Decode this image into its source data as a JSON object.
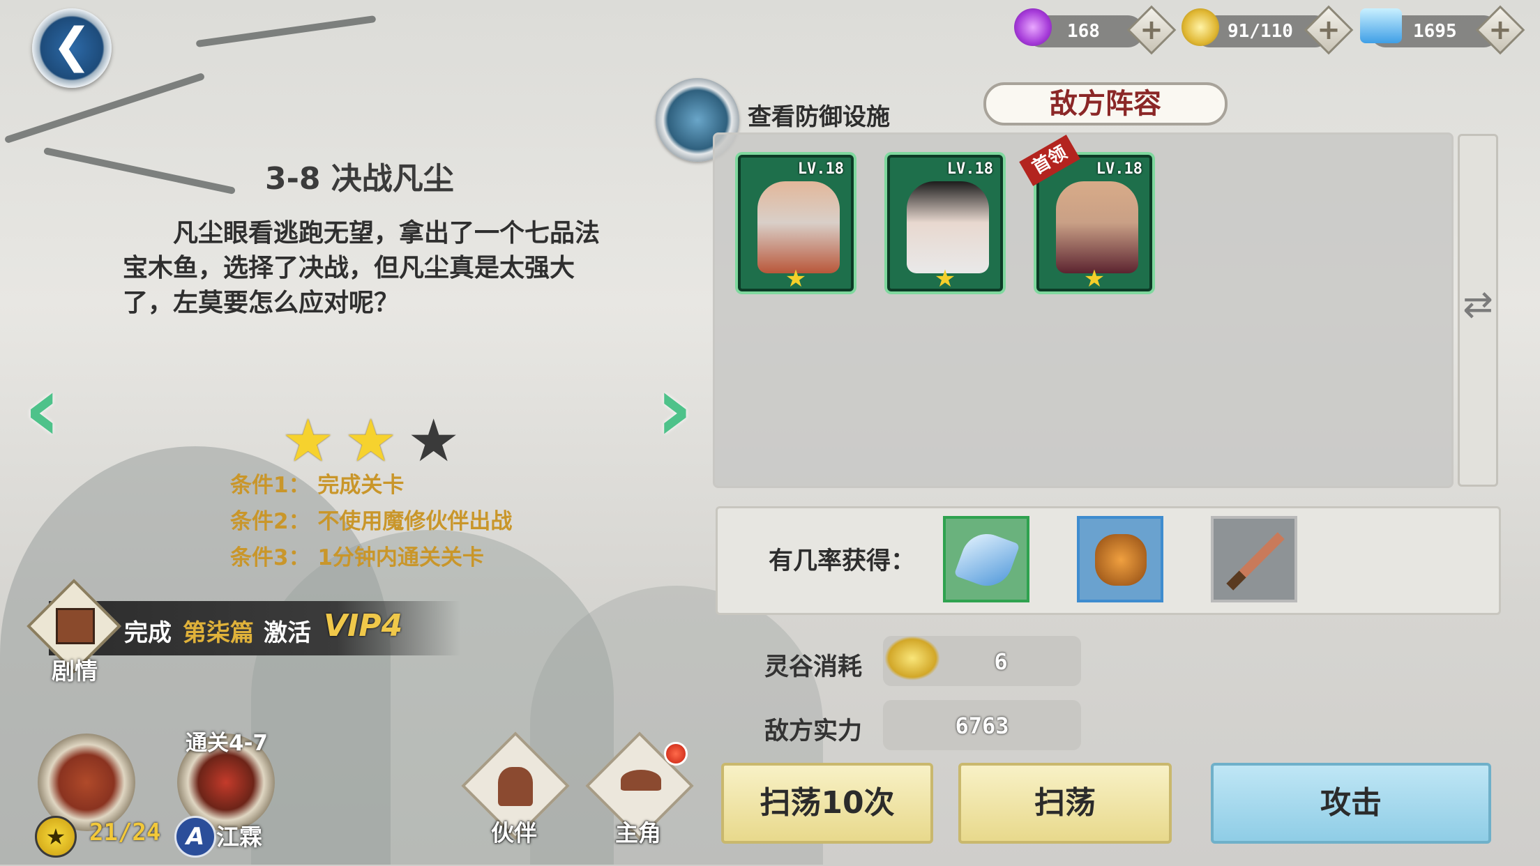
{
  "resources": {
    "spirit_orb": "168",
    "grain": "91/110",
    "diamond": "1695"
  },
  "level": {
    "title": "3-8 决战凡尘",
    "description": "凡尘眼看逃跑无望，拿出了一个七品法宝木鱼，选择了决战，但凡尘真是太强大了，左莫要怎么应对呢？",
    "stars_earned": 2,
    "stars_total": 3,
    "conditions": [
      "条件1： 完成关卡",
      "条件2： 不使用魔修伙伴出战",
      "条件3： 1分钟内通关关卡"
    ]
  },
  "vip_banner": {
    "prefix": "完成",
    "chapter": "第柒篇",
    "middle": "激活",
    "vip": "VIP4",
    "icon_label": "剧情"
  },
  "defense": {
    "label": "查看防御设施"
  },
  "enemy": {
    "header": "敌方阵容",
    "heroes": [
      {
        "level": "LV.18",
        "stars": 1,
        "boss": false
      },
      {
        "level": "LV.18",
        "stars": 1,
        "boss": false
      },
      {
        "level": "LV.18",
        "stars": 1,
        "boss": true,
        "boss_tag": "首领"
      }
    ]
  },
  "drops": {
    "label": "有几率获得：",
    "items": [
      "blue-crystal-icon",
      "ore-icon",
      "sword-icon"
    ]
  },
  "stats": {
    "grain_cost_label": "灵谷消耗",
    "grain_cost": "6",
    "enemy_power_label": "敌方实力",
    "enemy_power": "6763"
  },
  "actions": {
    "sweep10": "扫荡10次",
    "sweep": "扫荡",
    "attack": "攻击"
  },
  "bottom": {
    "chest_progress": "21/24",
    "clear_label": "通关4-7",
    "player_name": "江霖",
    "partner": "伙伴",
    "protagonist": "主角"
  },
  "colors": {
    "accent_green": "#4ec28a",
    "condition_gold": "#c9962a",
    "enemy_header_red": "#8b2727"
  }
}
